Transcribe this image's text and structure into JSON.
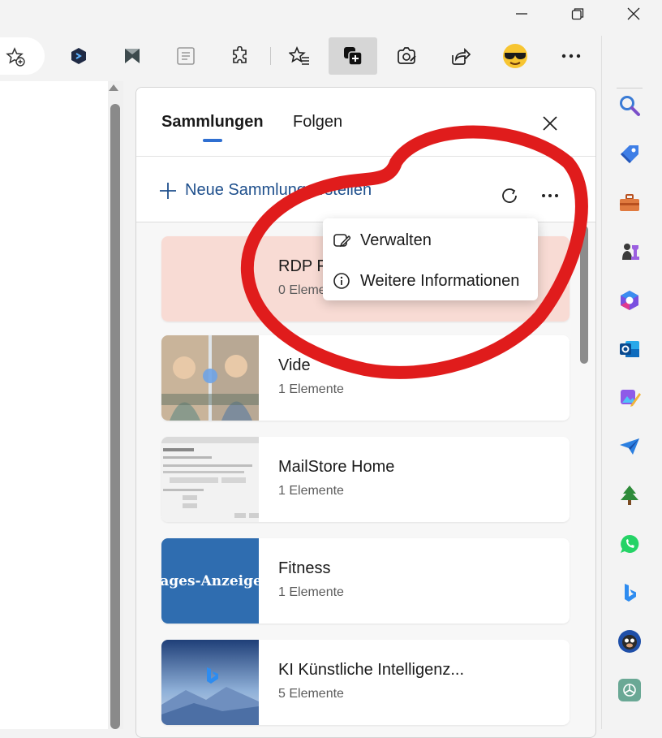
{
  "window_controls": {
    "minimize": "minimize",
    "maximize": "maximize",
    "close": "close"
  },
  "toolbar": {
    "icons": [
      "favorites-add-icon",
      "extension-1-icon",
      "extension-2-icon",
      "reader-view-icon",
      "extensions-icon",
      "favorites-icon",
      "collections-icon",
      "web-capture-icon",
      "share-icon",
      "emoji-extension-icon",
      "more-icon",
      "bing-chat-icon"
    ]
  },
  "panel": {
    "tabs": [
      {
        "label": "Sammlungen",
        "active": true
      },
      {
        "label": "Folgen",
        "active": false
      }
    ],
    "new_collection_label": "Neue Sammlung erstellen",
    "accent_color": "#2f6fd1"
  },
  "collections": [
    {
      "title": "RDP F",
      "subtitle": "0 Eleme"
    },
    {
      "title": "Vide",
      "subtitle": "1 Elemente"
    },
    {
      "title": "MailStore Home",
      "subtitle": "1 Elemente"
    },
    {
      "title": "Fitness",
      "subtitle": "1 Elemente",
      "thumb_text": "Tages-Anzeiger"
    },
    {
      "title": "KI Künstliche Intelligenz...",
      "subtitle": "5 Elemente"
    }
  ],
  "context_menu": {
    "items": [
      {
        "label": "Verwalten",
        "icon": "edit-collection-icon"
      },
      {
        "label": "Weitere Informationen",
        "icon": "info-icon"
      }
    ]
  },
  "sidebar": {
    "icons": [
      "search-icon",
      "shopping-tag-icon",
      "tools-icon",
      "games-icon",
      "microsoft365-icon",
      "outlook-icon",
      "designer-icon",
      "drop-icon",
      "tree-icon",
      "whatsapp-icon",
      "bing-icon",
      "monkey-icon",
      "chatgpt-icon"
    ]
  },
  "annotation_color": "#e01c1c"
}
